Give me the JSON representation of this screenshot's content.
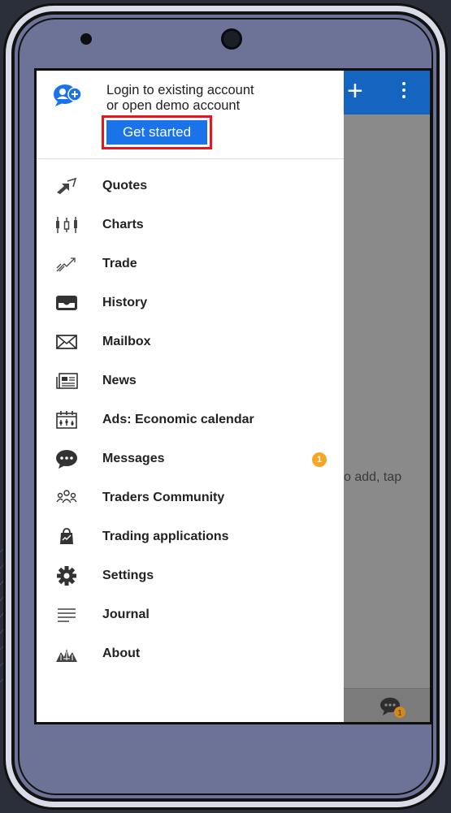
{
  "drawer": {
    "login_text_line1": "Login to existing account",
    "login_text_line2": "or open demo account",
    "get_started_label": "Get started"
  },
  "menu": {
    "items": [
      {
        "label": "Quotes",
        "icon": "quotes-icon"
      },
      {
        "label": "Charts",
        "icon": "charts-icon"
      },
      {
        "label": "Trade",
        "icon": "trade-icon"
      },
      {
        "label": "History",
        "icon": "history-icon"
      },
      {
        "label": "Mailbox",
        "icon": "mailbox-icon"
      },
      {
        "label": "News",
        "icon": "news-icon"
      },
      {
        "label": "Ads: Economic calendar",
        "icon": "calendar-icon"
      },
      {
        "label": "Messages",
        "icon": "messages-icon",
        "badge": "1"
      },
      {
        "label": "Traders Community",
        "icon": "community-icon"
      },
      {
        "label": "Trading applications",
        "icon": "applications-icon"
      },
      {
        "label": "Settings",
        "icon": "settings-icon"
      },
      {
        "label": "Journal",
        "icon": "journal-icon"
      },
      {
        "label": "About",
        "icon": "about-icon"
      }
    ]
  },
  "background": {
    "hint_text": "o add, tap",
    "chat_badge": "1"
  },
  "colors": {
    "app_bar": "#1565c0",
    "button": "#1a73e8",
    "highlight_border": "#e8141e",
    "badge": "#f5a623"
  }
}
